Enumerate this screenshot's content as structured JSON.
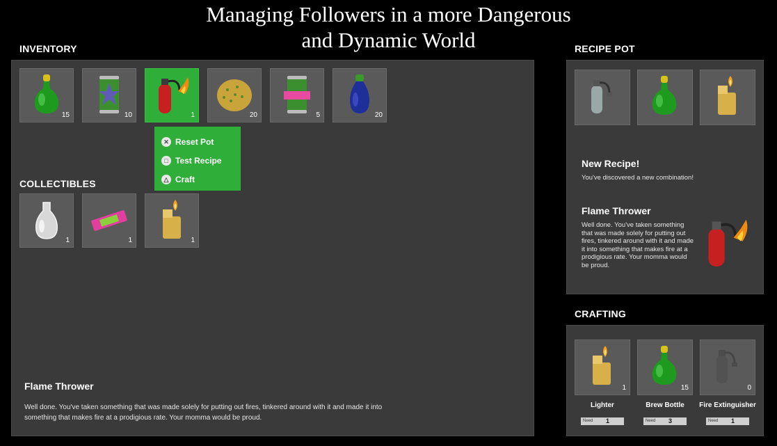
{
  "title": {
    "line1": "Managing Followers in a more Dangerous",
    "line2": "and Dynamic World"
  },
  "inventory": {
    "label": "INVENTORY",
    "items": [
      {
        "icon": "green-potion-icon",
        "qty": "15"
      },
      {
        "icon": "soda-can-icon",
        "qty": "10"
      },
      {
        "icon": "flame-thrower-icon",
        "qty": "1",
        "selected": true
      },
      {
        "icon": "cookie-icon",
        "qty": "20"
      },
      {
        "icon": "taped-can-icon",
        "qty": "5"
      },
      {
        "icon": "blue-potion-icon",
        "qty": "20"
      }
    ]
  },
  "context_menu": {
    "items": [
      {
        "glyph": "✕",
        "label": "Reset Pot"
      },
      {
        "glyph": "□",
        "label": "Test Recipe"
      },
      {
        "glyph": "△",
        "label": "Craft"
      }
    ]
  },
  "collectibles": {
    "label": "COLLECTIBLES",
    "items": [
      {
        "icon": "empty-bottle-icon",
        "qty": "1"
      },
      {
        "icon": "gum-pack-icon",
        "qty": "1"
      },
      {
        "icon": "lighter-icon",
        "qty": "1"
      }
    ]
  },
  "description": {
    "title": "Flame Thrower",
    "text": "Well done. You've taken something that was made solely for putting out fires, tinkered around with it and made it into something that makes fire at a prodigious rate. Your momma would be proud."
  },
  "recipe_pot": {
    "label": "RECIPE POT",
    "items": [
      {
        "icon": "fire-extinguisher-icon"
      },
      {
        "icon": "green-potion-icon"
      },
      {
        "icon": "lighter-icon"
      }
    ],
    "new_recipe_title": "New Recipe!",
    "new_recipe_text": "You've discovered a new combination!",
    "result_title": "Flame Thrower",
    "result_text": "Well done. You've taken something that was made solely for putting out fires, tinkered around with it and made it into something that makes fire at a prodigious rate. Your momma would be proud."
  },
  "crafting": {
    "label": "CRAFTING",
    "items": [
      {
        "icon": "lighter-icon",
        "qty": "1",
        "name": "Lighter",
        "need_label": "Need",
        "need": "1"
      },
      {
        "icon": "green-potion-icon",
        "qty": "15",
        "name": "Brew Bottle",
        "need_label": "Need",
        "need": "3"
      },
      {
        "icon": "fire-extinguisher-icon",
        "qty": "0",
        "name": "Fire Extinguisher",
        "need_label": "Need",
        "need": "1"
      }
    ]
  },
  "colors": {
    "selected": "#2fae3a",
    "panel": "#3a3a3a",
    "slot": "#5a5a5a"
  }
}
